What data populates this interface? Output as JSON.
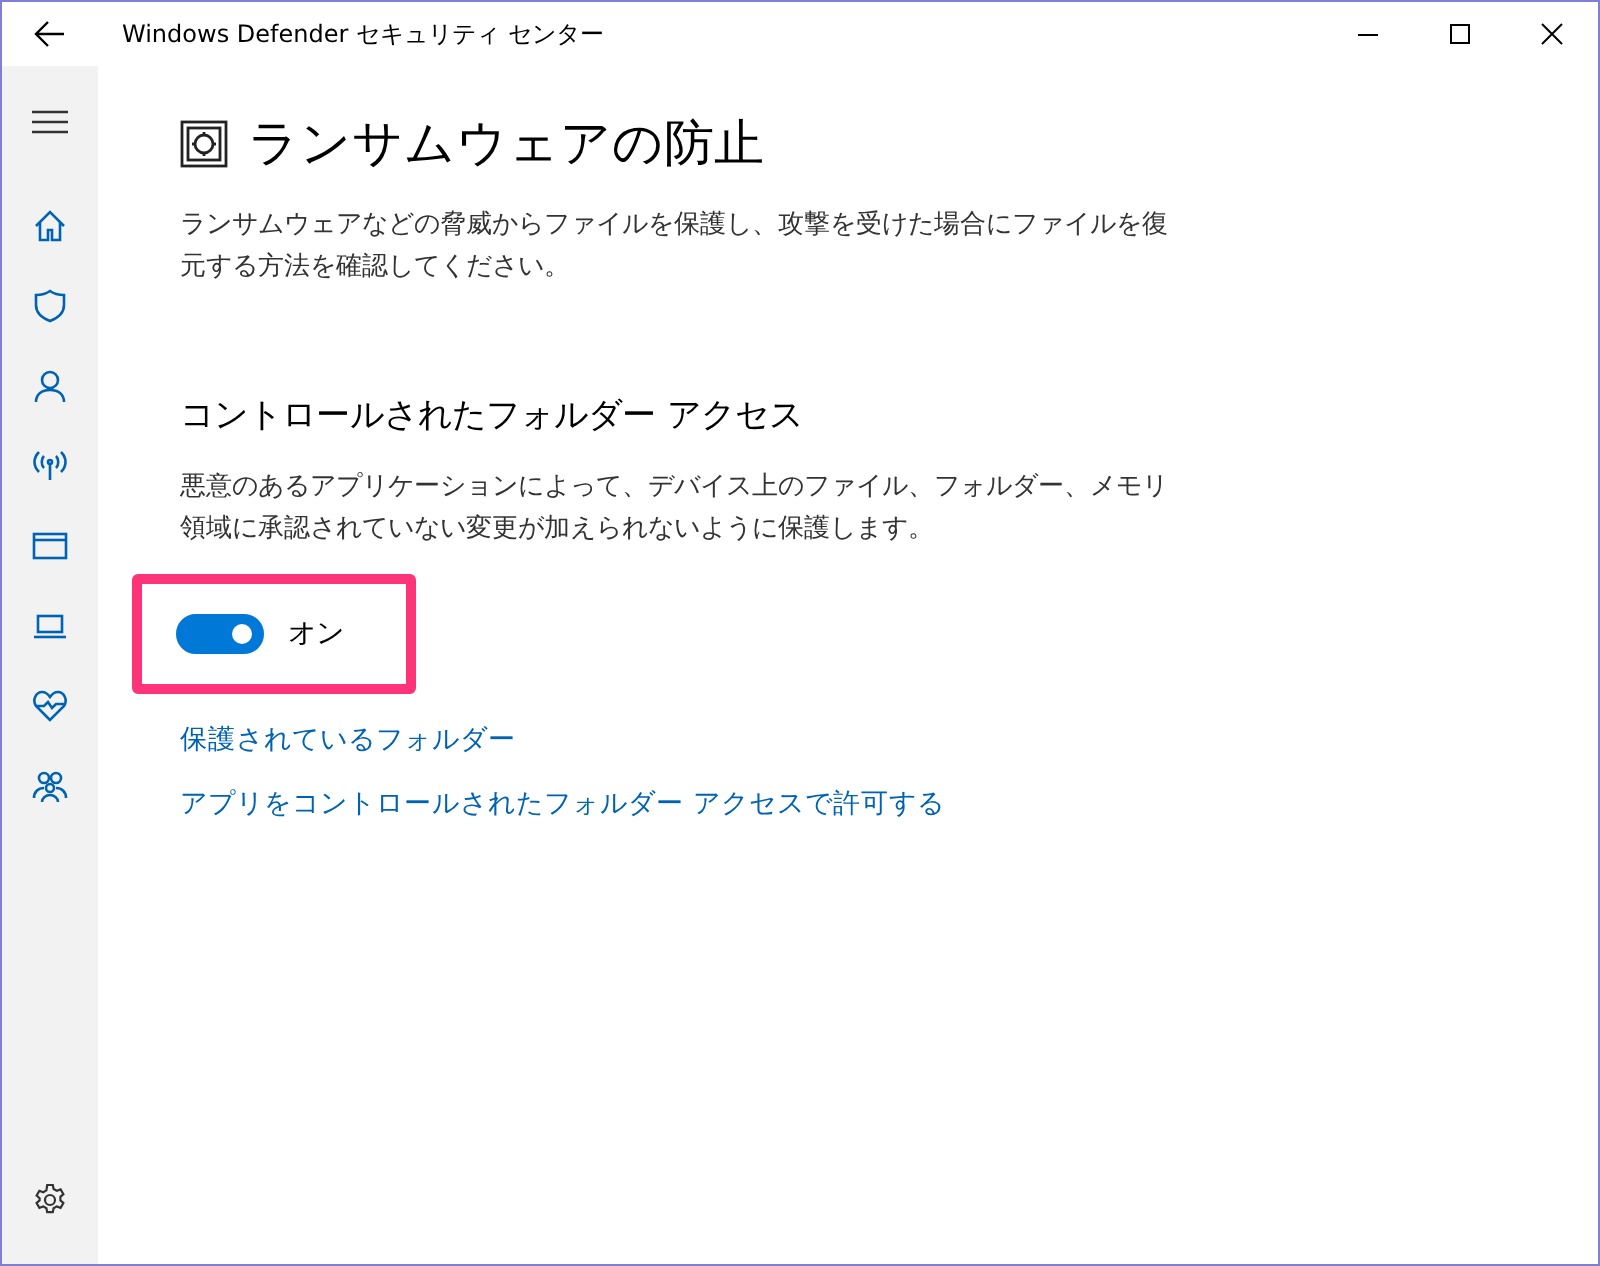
{
  "window": {
    "title": "Windows Defender セキュリティ センター"
  },
  "sidebar": {
    "nav_items": [
      {
        "kind": "home"
      },
      {
        "kind": "shield"
      },
      {
        "kind": "person"
      },
      {
        "kind": "wireless"
      },
      {
        "kind": "window"
      },
      {
        "kind": "laptop"
      },
      {
        "kind": "heart"
      },
      {
        "kind": "family"
      }
    ]
  },
  "page": {
    "title": "ランサムウェアの防止",
    "description": "ランサムウェアなどの脅威からファイルを保護し、攻撃を受けた場合にファイルを復元する方法を確認してください。",
    "section": {
      "title": "コントロールされたフォルダー アクセス",
      "description": "悪意のあるアプリケーションによって、デバイス上のファイル、フォルダー、メモリ領域に承認されていない変更が加えられないように保護します。",
      "toggle": {
        "on": true,
        "label": "オン",
        "highlighted": true
      },
      "links": [
        "保護されているフォルダー",
        "アプリをコントロールされたフォルダー アクセスで許可する"
      ]
    }
  }
}
